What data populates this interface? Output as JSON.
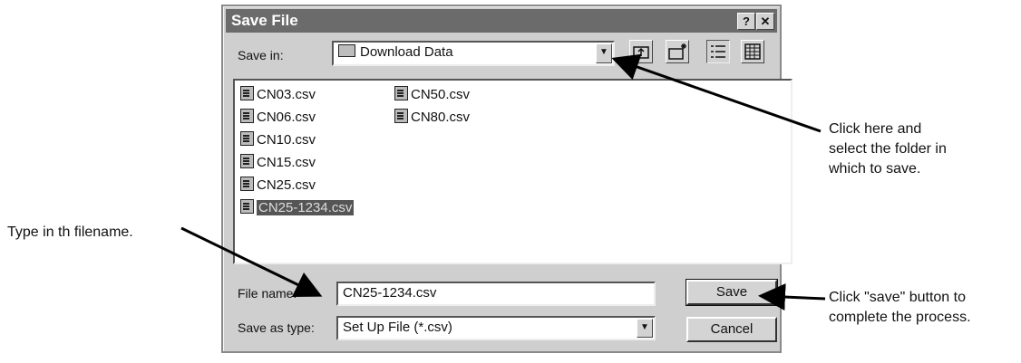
{
  "dialog": {
    "title": "Save File",
    "help_label": "?",
    "close_label": "✕",
    "save_in_label": "Save in:",
    "save_in_value": "Download Data",
    "files": [
      {
        "name": "CN03.csv"
      },
      {
        "name": "CN06.csv"
      },
      {
        "name": "CN10.csv"
      },
      {
        "name": "CN15.csv"
      },
      {
        "name": "CN25.csv"
      },
      {
        "name": "CN25-1234.csv",
        "selected": true
      },
      {
        "name": "CN50.csv"
      },
      {
        "name": "CN80.csv"
      }
    ],
    "filename_label": "File name:",
    "filename_value": "CN25-1234.csv",
    "type_label": "Save as type:",
    "type_value": "Set Up File (*.csv)",
    "save_button": "Save",
    "cancel_button": "Cancel"
  },
  "annotations": {
    "folder_hint": [
      "Click here and",
      "select the folder in",
      "which to save."
    ],
    "filename_hint": "Type in th filename.",
    "save_hint": [
      "Click \"save\" button to",
      "complete the process."
    ]
  },
  "icons": [
    "folder-icon",
    "up-folder-icon",
    "new-folder-icon",
    "list-view-icon",
    "details-view-icon",
    "csv-file-icon",
    "dropdown-arrow-icon"
  ],
  "colors": {
    "dialog_bg": "#cfcfcf",
    "titlebar_bg": "#6b6b6b",
    "selection_bg": "#555555"
  }
}
